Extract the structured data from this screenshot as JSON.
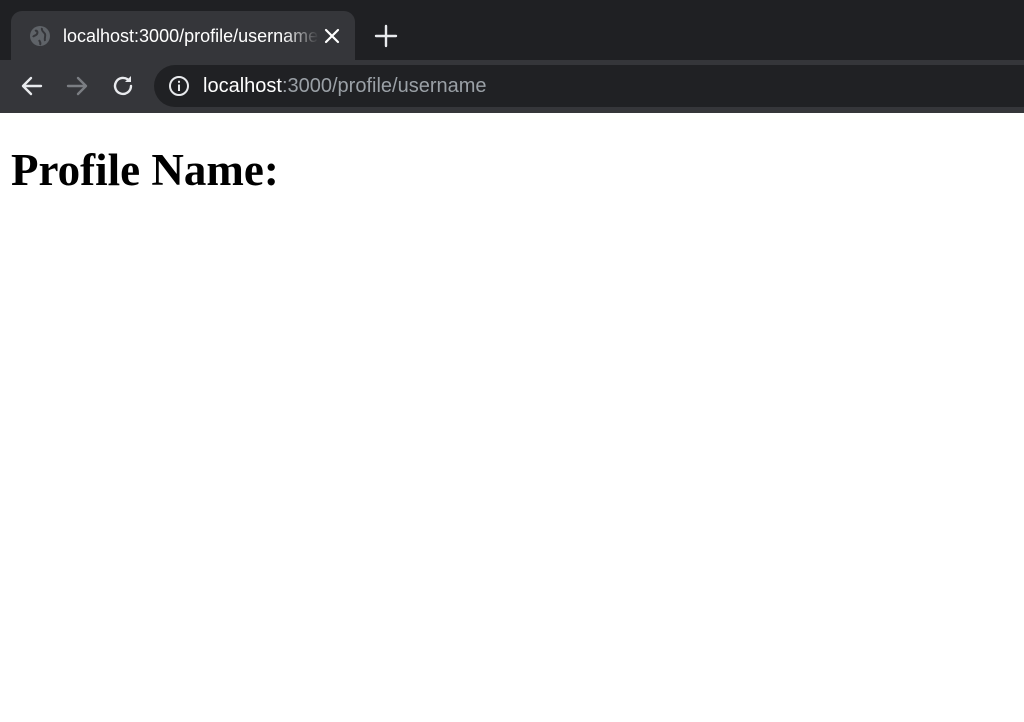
{
  "browser": {
    "tab": {
      "title": "localhost:3000/profile/username",
      "favicon": "globe-icon",
      "close_icon": "close-icon"
    },
    "new_tab_icon": "plus-icon",
    "toolbar": {
      "back_icon": "arrow-left-icon",
      "forward_icon": "arrow-right-icon",
      "reload_icon": "reload-icon",
      "site_info_icon": "info-icon",
      "url_host": "localhost",
      "url_rest": ":3000/profile/username"
    },
    "colors": {
      "tab_strip": "#1f2023",
      "active_tab": "#35363a",
      "omnibox": "#202124",
      "url_muted": "#9aa0a6"
    }
  },
  "page": {
    "heading": "Profile Name:"
  }
}
